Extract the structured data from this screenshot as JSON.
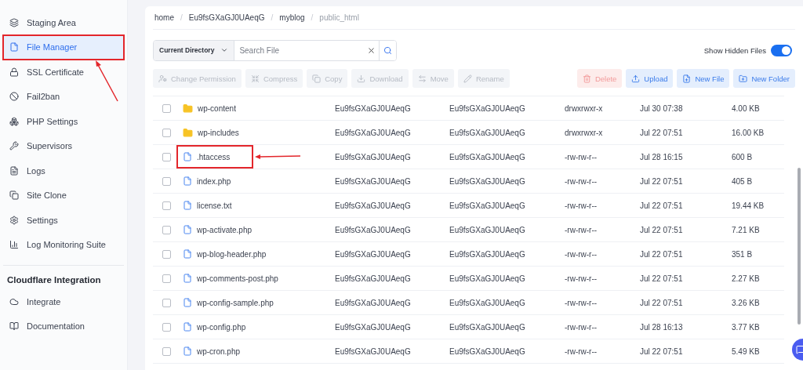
{
  "sidebar": {
    "items": [
      {
        "label": "Staging Area",
        "selected": false,
        "highlighted": false
      },
      {
        "label": "File Manager",
        "selected": true,
        "highlighted": true
      },
      {
        "label": "SSL Certificate",
        "selected": false,
        "highlighted": false
      },
      {
        "label": "Fail2ban",
        "selected": false,
        "highlighted": false
      },
      {
        "label": "PHP Settings",
        "selected": false,
        "highlighted": false
      },
      {
        "label": "Supervisors",
        "selected": false,
        "highlighted": false
      },
      {
        "label": "Logs",
        "selected": false,
        "highlighted": false
      },
      {
        "label": "Site Clone",
        "selected": false,
        "highlighted": false
      },
      {
        "label": "Settings",
        "selected": false,
        "highlighted": false
      },
      {
        "label": "Log Monitoring Suite",
        "selected": false,
        "highlighted": false
      }
    ],
    "section": {
      "title": "Cloudflare Integration",
      "items": [
        {
          "label": "Integrate",
          "selected": false,
          "highlighted": false
        },
        {
          "label": "Documentation",
          "selected": false,
          "highlighted": false
        }
      ]
    }
  },
  "breadcrumb": {
    "separator": "/",
    "items": [
      "home",
      "Eu9fsGXaGJ0UAeqG",
      "myblog",
      "public_html"
    ]
  },
  "search": {
    "scope": "Current Directory",
    "placeholder": "Search File"
  },
  "show_hidden": {
    "label": "Show Hidden Files",
    "on": true
  },
  "toolbar": [
    {
      "label": "Change Permission",
      "kind": "disabled"
    },
    {
      "label": "Compress",
      "kind": "disabled"
    },
    {
      "label": "Copy",
      "kind": "disabled"
    },
    {
      "label": "Download",
      "kind": "disabled"
    },
    {
      "label": "Move",
      "kind": "disabled"
    },
    {
      "label": "Rename",
      "kind": "disabled"
    }
  ],
  "actions": [
    {
      "label": "Delete",
      "kind": "danger"
    },
    {
      "label": "Upload",
      "kind": "primary"
    },
    {
      "label": "New File",
      "kind": "primary"
    },
    {
      "label": "New Folder",
      "kind": "primary"
    }
  ],
  "rows": [
    {
      "name": "wp-content",
      "kind": "folder",
      "owner": "Eu9fsGXaGJ0UAeqG",
      "group": "Eu9fsGXaGJ0UAeqG",
      "permissions": "drwxrwxr-x",
      "modified": "Jul 30 07:38",
      "size": "4.00 KB",
      "checked": false,
      "highlighted": false
    },
    {
      "name": "wp-includes",
      "kind": "folder",
      "owner": "Eu9fsGXaGJ0UAeqG",
      "group": "Eu9fsGXaGJ0UAeqG",
      "permissions": "drwxrwxr-x",
      "modified": "Jul 22 07:51",
      "size": "16.00 KB",
      "checked": false,
      "highlighted": false
    },
    {
      "name": ".htaccess",
      "kind": "file",
      "owner": "Eu9fsGXaGJ0UAeqG",
      "group": "Eu9fsGXaGJ0UAeqG",
      "permissions": "-rw-rw-r--",
      "modified": "Jul 28 16:15",
      "size": "600 B",
      "checked": false,
      "highlighted": true
    },
    {
      "name": "index.php",
      "kind": "file",
      "owner": "Eu9fsGXaGJ0UAeqG",
      "group": "Eu9fsGXaGJ0UAeqG",
      "permissions": "-rw-rw-r--",
      "modified": "Jul 22 07:51",
      "size": "405 B",
      "checked": false,
      "highlighted": false
    },
    {
      "name": "license.txt",
      "kind": "file",
      "owner": "Eu9fsGXaGJ0UAeqG",
      "group": "Eu9fsGXaGJ0UAeqG",
      "permissions": "-rw-rw-r--",
      "modified": "Jul 22 07:51",
      "size": "19.44 KB",
      "checked": false,
      "highlighted": false
    },
    {
      "name": "wp-activate.php",
      "kind": "file",
      "owner": "Eu9fsGXaGJ0UAeqG",
      "group": "Eu9fsGXaGJ0UAeqG",
      "permissions": "-rw-rw-r--",
      "modified": "Jul 22 07:51",
      "size": "7.21 KB",
      "checked": false,
      "highlighted": false
    },
    {
      "name": "wp-blog-header.php",
      "kind": "file",
      "owner": "Eu9fsGXaGJ0UAeqG",
      "group": "Eu9fsGXaGJ0UAeqG",
      "permissions": "-rw-rw-r--",
      "modified": "Jul 22 07:51",
      "size": "351 B",
      "checked": false,
      "highlighted": false
    },
    {
      "name": "wp-comments-post.php",
      "kind": "file",
      "owner": "Eu9fsGXaGJ0UAeqG",
      "group": "Eu9fsGXaGJ0UAeqG",
      "permissions": "-rw-rw-r--",
      "modified": "Jul 22 07:51",
      "size": "2.27 KB",
      "checked": false,
      "highlighted": false
    },
    {
      "name": "wp-config-sample.php",
      "kind": "file",
      "owner": "Eu9fsGXaGJ0UAeqG",
      "group": "Eu9fsGXaGJ0UAeqG",
      "permissions": "-rw-rw-r--",
      "modified": "Jul 22 07:51",
      "size": "3.26 KB",
      "checked": false,
      "highlighted": false
    },
    {
      "name": "wp-config.php",
      "kind": "file",
      "owner": "Eu9fsGXaGJ0UAeqG",
      "group": "Eu9fsGXaGJ0UAeqG",
      "permissions": "-rw-rw-r--",
      "modified": "Jul 28 16:13",
      "size": "3.77 KB",
      "checked": false,
      "highlighted": false
    },
    {
      "name": "wp-cron.php",
      "kind": "file",
      "owner": "Eu9fsGXaGJ0UAeqG",
      "group": "Eu9fsGXaGJ0UAeqG",
      "permissions": "-rw-rw-r--",
      "modified": "Jul 22 07:51",
      "size": "5.49 KB",
      "checked": false,
      "highlighted": false
    }
  ]
}
